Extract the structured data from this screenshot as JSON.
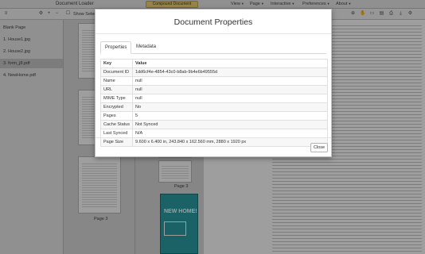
{
  "app": {
    "title": "Document Loader",
    "doc_button": "Compound Document",
    "menus": [
      "View",
      "Page",
      "Interactive",
      "Preferences",
      "About"
    ],
    "toolbar_label": "Show Selected"
  },
  "sidebar": {
    "items": [
      {
        "label": "Blank Page"
      },
      {
        "label": "1. House1.jpg"
      },
      {
        "label": "2. House2.jpg"
      },
      {
        "label": "3. form_j8.pdf"
      },
      {
        "label": "4. NewHome.pdf"
      }
    ]
  },
  "thumbnails": {
    "labels": [
      "Page 3",
      "Page 3"
    ]
  },
  "promo": {
    "headline": "NEW HOME!"
  },
  "modal": {
    "title": "Document Properties",
    "tabs": [
      {
        "label": "Properties"
      },
      {
        "label": "Metadata"
      }
    ],
    "columns": {
      "key": "Key",
      "value": "Value"
    },
    "rows": [
      {
        "key": "Document ID",
        "value": "1dd6cf4e-4854-43c0-b8ab-9b4e6b49555d"
      },
      {
        "key": "Name",
        "value": "null"
      },
      {
        "key": "URL",
        "value": "null"
      },
      {
        "key": "MIME Type",
        "value": "null"
      },
      {
        "key": "Encrypted",
        "value": "No"
      },
      {
        "key": "Pages",
        "value": "5"
      },
      {
        "key": "Cache Status",
        "value": "Not Synced"
      },
      {
        "key": "Last Synced",
        "value": "N/A"
      },
      {
        "key": "Page Size",
        "value": "9.600 x 6.400 in, 243.840 x 162.560 mm, 2880 x 1920 px"
      }
    ],
    "close_label": "Close"
  }
}
